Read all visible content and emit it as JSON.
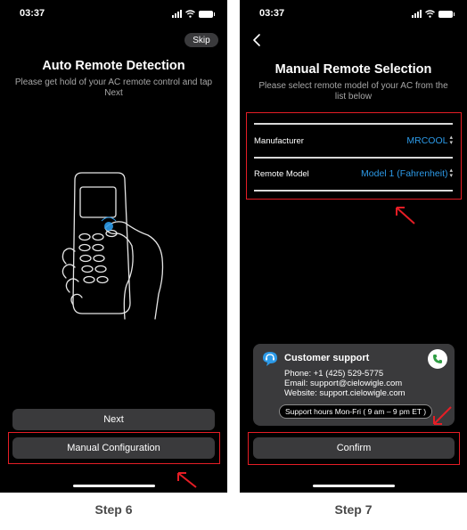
{
  "screen1": {
    "time": "03:37",
    "skip_label": "Skip",
    "title": "Auto Remote Detection",
    "subtitle": "Please get hold of your AC remote control and tap Next",
    "next_label": "Next",
    "manual_label": "Manual Configuration",
    "step_label": "Step 6"
  },
  "screen2": {
    "time": "03:37",
    "title": "Manual Remote Selection",
    "subtitle": "Please select remote model of your AC from the list below",
    "manufacturer_label": "Manufacturer",
    "manufacturer_value": "MRCOOL",
    "model_label": "Remote Model",
    "model_value": "Model 1 (Fahrenheit)",
    "support": {
      "title": "Customer support",
      "phone": "Phone: +1 (425) 529-5775",
      "email": "Email: support@cielowigle.com",
      "website": "Website: support.cielowigle.com",
      "hours": "Support hours Mon-Fri ( 9 am – 9 pm ET )"
    },
    "confirm_label": "Confirm",
    "step_label": "Step 7"
  },
  "icons": {
    "back": "chevron-left-icon",
    "support": "headset-chat-icon",
    "call": "phone-icon",
    "select": "chevron-up-down-icon"
  },
  "colors": {
    "highlight": "#e51d25",
    "accent": "#2c9ae8",
    "button": "#3a3a3c",
    "call_icon": "#2f9e44"
  }
}
